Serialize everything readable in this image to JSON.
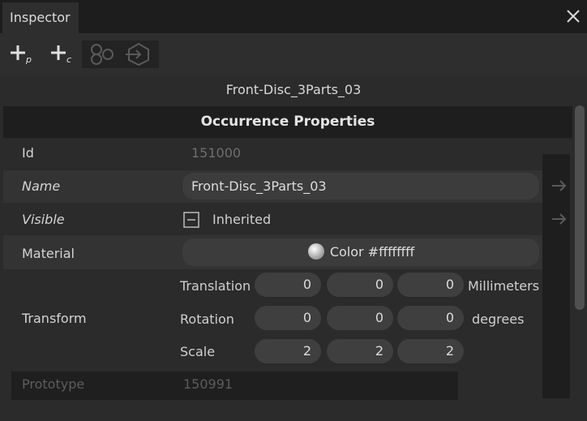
{
  "window": {
    "tab_title": "Inspector",
    "close_icon": "close-icon"
  },
  "toolbar": {
    "add_prototype_label": "+p",
    "add_component_label": "+c"
  },
  "occurrence_name": "Front-Disc_3Parts_03",
  "section_title": "Occurrence Properties",
  "properties": {
    "id": {
      "label": "Id",
      "value": "151000"
    },
    "name": {
      "label": "Name",
      "value": "Front-Disc_3Parts_03"
    },
    "visible": {
      "label": "Visible",
      "value": "Inherited"
    },
    "material": {
      "label": "Material",
      "value": "Color #ffffffff"
    },
    "transform": {
      "label": "Transform",
      "translation": {
        "label": "Translation",
        "x": "0",
        "y": "0",
        "z": "0",
        "unit": "Millimeters"
      },
      "rotation": {
        "label": "Rotation",
        "x": "0",
        "y": "0",
        "z": "0",
        "unit": "degrees"
      },
      "scale": {
        "label": "Scale",
        "x": "2",
        "y": "2",
        "z": "2"
      }
    },
    "prototype": {
      "label": "Prototype",
      "value": "150991"
    }
  },
  "colors": {
    "background": "#2b2b2b",
    "header": "#1e1e1e",
    "field": "#3c3c3c"
  }
}
